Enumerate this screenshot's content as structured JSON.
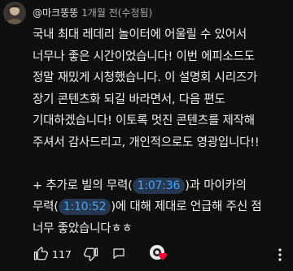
{
  "comment": {
    "author": "@마크뚱뚱",
    "time": "1개월 전(수정됨)",
    "lines": [
      "국내 최대 레데리 놀이터에 어울릴 수 있어서",
      "너무나 좋은 시간이었습니다! 이번 에피소드도",
      "정말 재밌게 시청했습니다. 이 설명회 시리즈가",
      "장기 콘텐츠화 되길 바라면서, 다음 편도",
      "기대하겠습니다! 이토록 멋진 콘텐츠를 제작해",
      "주셔서 감사드리고, 개인적으로도 영광입니다!!"
    ],
    "extra_line1_prefix": "+ 추가로 빌의 무력(",
    "timestamp1": "1:07:36",
    "extra_line1_suffix": ")과 마이카의",
    "extra_line2_prefix": "무력(",
    "timestamp2": "1:10:52",
    "extra_line2_suffix": ")에 대해 제대로 언급해 주신 점",
    "extra_line3": "너무 좋았습니다ㅎㅎ"
  },
  "actions": {
    "like_count": "117",
    "like_icon": "thumbs-up-icon",
    "dislike_icon": "thumbs-down-icon",
    "reply_icon": "reply-bubble-icon",
    "creator_heart_icon": "creator-heart-icon",
    "menu_icon": "more-vert-icon"
  },
  "colors": {
    "background": "#0f0f0f",
    "text": "#f1f1f1",
    "meta": "#aaaaaa",
    "timestamp_link": "#4aa3f5",
    "timestamp_bg": "#263850",
    "heart": "#ff0033"
  }
}
